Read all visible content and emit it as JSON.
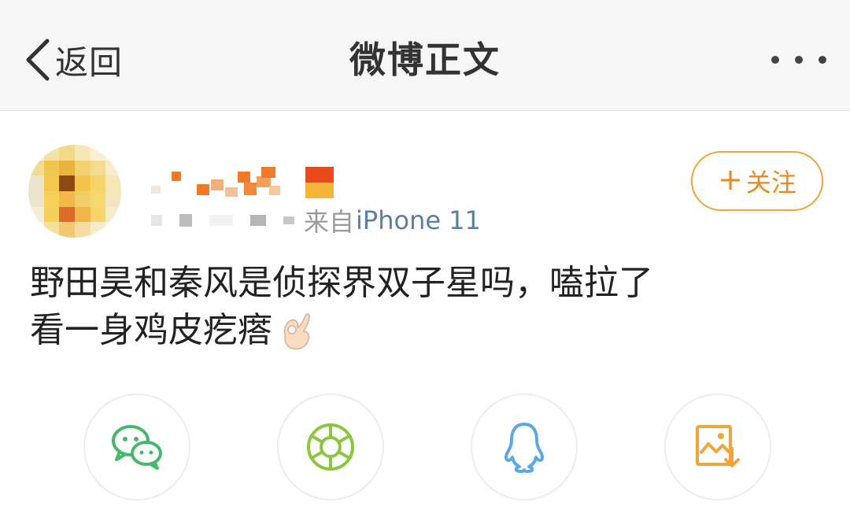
{
  "header": {
    "back_label": "返回",
    "title": "微博正文",
    "more_icon": "more-dots-icon"
  },
  "post": {
    "source_prefix": "来自",
    "source_device": "iPhone 11",
    "follow_label": "关注",
    "text": "野田昊和秦风是侦探界双子星吗，嗑拉了\n看一身鸡皮疙瘩",
    "emoji": "ok-hand-emoji"
  },
  "share": {
    "items": [
      {
        "icon": "wechat-icon",
        "color": "#46b86a"
      },
      {
        "icon": "moments-icon",
        "color": "#8cc63f"
      },
      {
        "icon": "qq-icon",
        "color": "#5aa9e6"
      },
      {
        "icon": "save-image-icon",
        "color": "#f2a33a"
      }
    ]
  },
  "colors": {
    "accent": "#ee8a1b",
    "link": "#5b7ea3",
    "header_bg": "#f6f6f6"
  }
}
